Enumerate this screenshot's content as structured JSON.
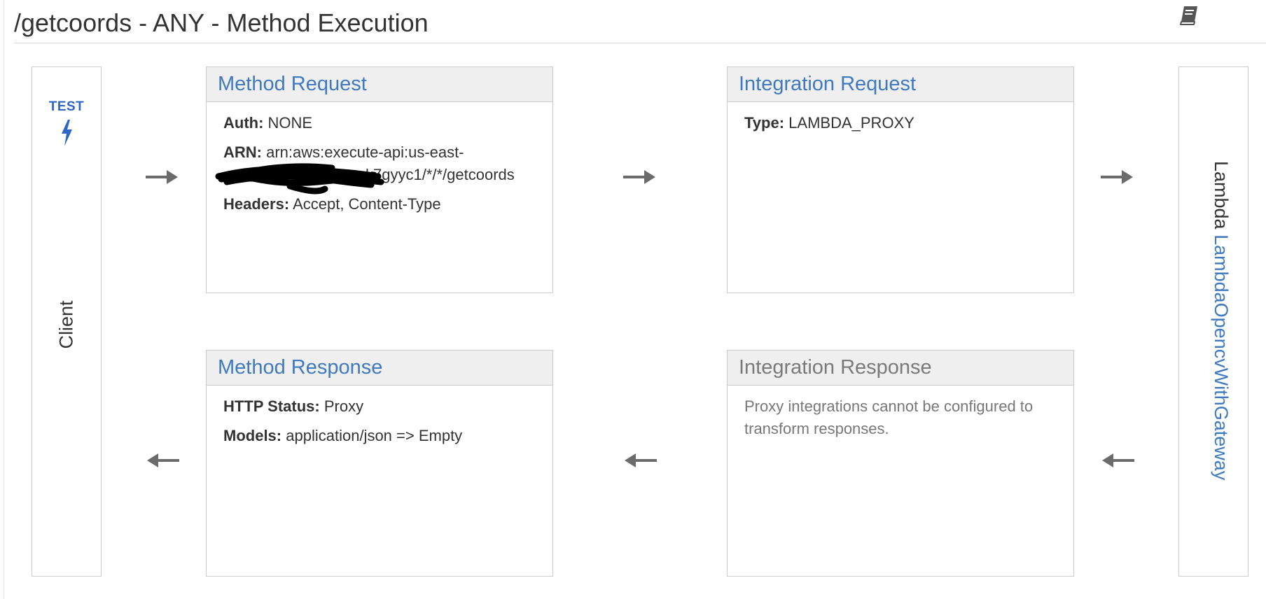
{
  "header": {
    "title": "/getcoords - ANY - Method Execution",
    "docs_icon": "book-icon"
  },
  "client": {
    "test_label": "TEST",
    "test_icon": "lightning-bolt-icon",
    "label": "Client"
  },
  "method_request": {
    "title": "Method Request",
    "auth_label": "Auth:",
    "auth_value": "NONE",
    "arn_label": "ARN:",
    "arn_line1": "arn:aws:execute-api:us-east-",
    "arn_line2": "k7gyyc1/*/*/getcoords",
    "headers_label": "Headers:",
    "headers_value": "Accept, Content-Type"
  },
  "integration_request": {
    "title": "Integration Request",
    "type_label": "Type:",
    "type_value": "LAMBDA_PROXY"
  },
  "method_response": {
    "title": "Method Response",
    "status_label": "HTTP Status:",
    "status_value": "Proxy",
    "models_label": "Models:",
    "models_value": "application/json => Empty"
  },
  "integration_response": {
    "title": "Integration Response",
    "note": "Proxy integrations cannot be configured to transform responses."
  },
  "lambda": {
    "prefix": "Lambda",
    "function_name": "LambdaOpencvWithGateway"
  },
  "colors": {
    "link": "#3f7ac0",
    "test": "#2d66c4",
    "arrow": "#6b6b6b",
    "border": "#cccccc",
    "header_bg": "#efefef"
  }
}
